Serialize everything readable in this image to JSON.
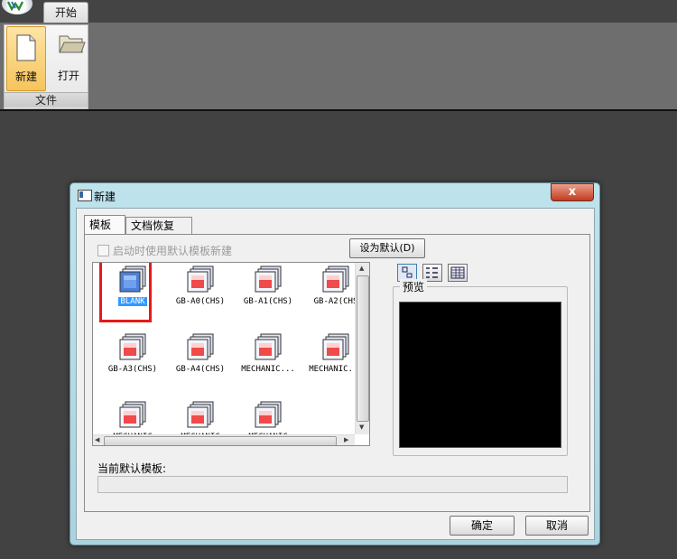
{
  "ribbon": {
    "tab_start": "开始",
    "new_label": "新建",
    "open_label": "打开",
    "group_label": "文件"
  },
  "dialog": {
    "title": "新建",
    "close_glyph": "x",
    "tabs": [
      "模板",
      "文档恢复"
    ],
    "startup_checkbox_label": "启动时使用默认模板新建",
    "set_default_button": "设为默认(D)",
    "templates": [
      {
        "caption": "BLANK",
        "selected": true
      },
      {
        "caption": "GB-A0(CHS)"
      },
      {
        "caption": "GB-A1(CHS)"
      },
      {
        "caption": "GB-A2(CHS"
      },
      {
        "caption": "GB-A3(CHS)"
      },
      {
        "caption": "GB-A4(CHS)"
      },
      {
        "caption": "MECHANIC..."
      },
      {
        "caption": "MECHANIC..."
      },
      {
        "caption": "MECHANIC"
      },
      {
        "caption": "MECHANIC"
      },
      {
        "caption": "MECHANIC"
      }
    ],
    "preview_label": "预览",
    "current_default_label": "当前默认模板:",
    "current_default_value": "",
    "ok_button": "确定",
    "cancel_button": "取消"
  },
  "colors": {
    "accent_selection": "#3399ff",
    "highlight_box": "#e51a1a",
    "preview_bg": "#000000"
  }
}
